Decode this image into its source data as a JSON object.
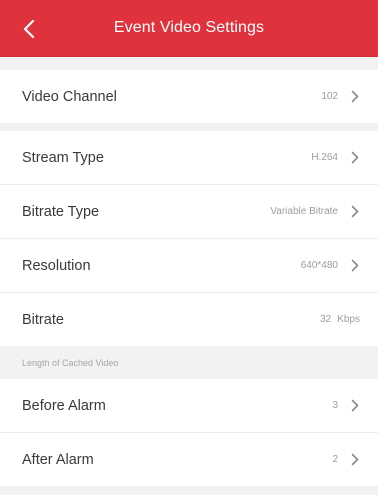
{
  "header": {
    "title": "Event Video Settings"
  },
  "video_channel": {
    "label": "Video Channel",
    "value": "102"
  },
  "stream_type": {
    "label": "Stream Type",
    "value": "H.264"
  },
  "bitrate_type": {
    "label": "Bitrate Type",
    "value": "Variable Bitrate"
  },
  "resolution": {
    "label": "Resolution",
    "value": "640*480"
  },
  "bitrate": {
    "label": "Bitrate",
    "value": "32",
    "unit": "Kbps"
  },
  "section": {
    "caption": "Length of Cached Video"
  },
  "before_alarm": {
    "label": "Before Alarm",
    "value": "3"
  },
  "after_alarm": {
    "label": "After Alarm",
    "value": "2"
  },
  "colors": {
    "header": "#e0323d",
    "background": "#f2f2f2"
  }
}
